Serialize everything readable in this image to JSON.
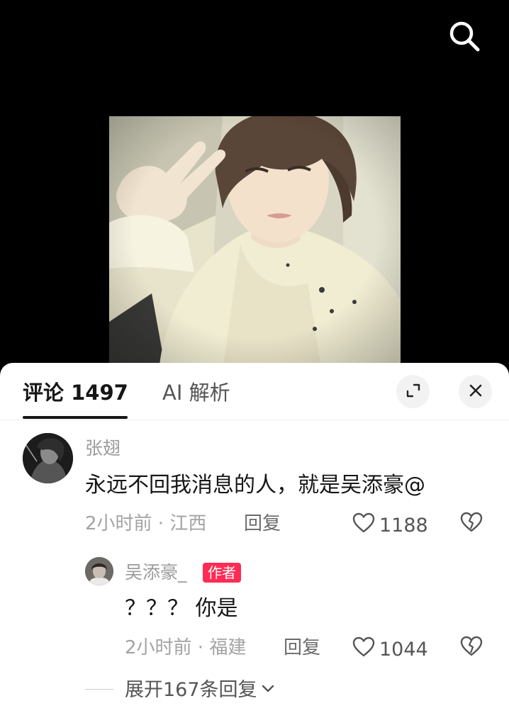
{
  "tabs": {
    "comments_label": "评论",
    "comments_count": "1497",
    "ai_label": "AI 解析"
  },
  "icons": {
    "search": "search-icon",
    "expand": "expand-icon",
    "close": "close-icon",
    "like": "heart-outline-icon",
    "dislike": "broken-heart-icon",
    "chevron": "chevron-down-icon"
  },
  "colors": {
    "accent": "#fe2c55",
    "sheet": "#ffffff",
    "background": "#000000"
  },
  "comments": [
    {
      "username": "张翅",
      "text": "永远不回我消息的人，就是吴添豪@",
      "time_location": "2小时前 · 江西",
      "reply_label": "回复",
      "likes": "1188"
    }
  ],
  "reply": {
    "username": "吴添豪_",
    "badge": "作者",
    "text": "？？？ 你是",
    "time_location": "2小时前 · 福建",
    "reply_label": "回复",
    "likes": "1044"
  },
  "expand_replies_label": "展开167条回复"
}
